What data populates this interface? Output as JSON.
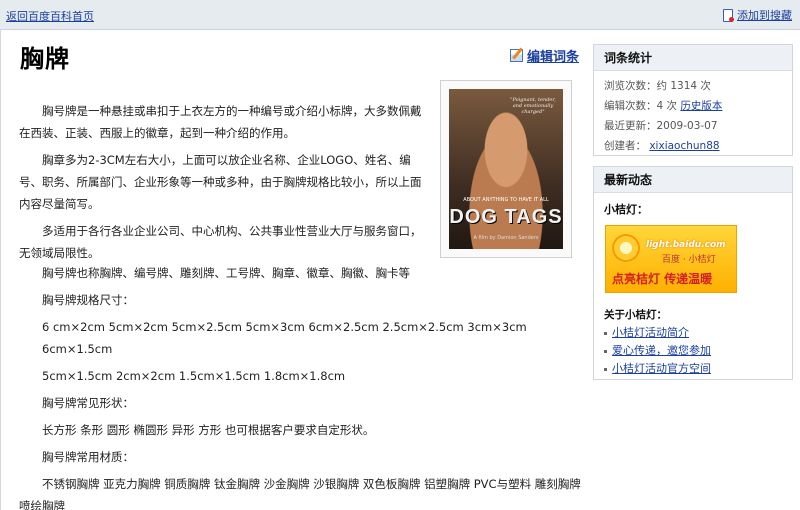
{
  "topbar": {
    "home_link": "返回百度百科首页",
    "favorite_link": "添加到搜藏"
  },
  "entry": {
    "title": "胸牌",
    "edit_label": "编辑词条"
  },
  "poster": {
    "quote": "\"Poignant, tender, and emotionally charged\"",
    "tags_line": "ABOUT ANYTHING TO HAVE IT ALL",
    "title": "DOG TAGS",
    "subtitle": "A film by Damion Sanders"
  },
  "article": {
    "p1": "胸号牌是一种悬挂或串扣于上衣左方的一种编号或介绍小标牌，大多数佩戴在西装、正装、西服上的徽章，起到一种介绍的作用。",
    "p2": "胸章多为2-3CM左右大小，上面可以放企业名称、企业LOGO、姓名、编号、职务、所属部门、企业形象等一种或多种，由于胸牌规格比较小，所以上面内容尽量简写。",
    "p3": "多适用于各行各业企业公司、中心机构、公共事业性营业大厅与服务窗口，无领域局限性。",
    "p4": "胸号牌也称胸牌、编号牌、雕刻牌、工号牌、胸章、徽章、胸徽、胸卡等",
    "p5": "胸号牌规格尺寸：",
    "spec1": "6 cm×2cm 5cm×2cm 5cm×2.5cm 5cm×3cm 6cm×2.5cm 2.5cm×2.5cm 3cm×3cm 6cm×1.5cm",
    "spec2": "5cm×1.5cm 2cm×2cm 1.5cm×1.5cm 1.8cm×1.8cm",
    "p6": "胸号牌常见形状：",
    "shapes": "长方形 条形 圆形 椭圆形 异形 方形 也可根据客户要求自定形状。",
    "p7": "胸号牌常用材质：",
    "materials": "不锈钢胸牌 亚克力胸牌 铜质胸牌 钛金胸牌 沙金胸牌 沙银胸牌 双色板胸牌 铝塑胸牌 PVC与塑料 雕刻胸牌 喷绘胸牌"
  },
  "stats": {
    "heading": "词条统计",
    "views_label": "浏览次数：约 1314 次",
    "edits_label": "编辑次数：4 次",
    "history_link": "历史版本",
    "updated_label": "最近更新：2009-03-07",
    "creator_label": "创建者：",
    "creator_link": "xixiaochun88"
  },
  "news": {
    "heading": "最新动态",
    "label": "小桔灯：",
    "banner_url": "light.baidu.com",
    "banner_sub": "百度 · 小桔灯",
    "banner_slogan": "点亮桔灯 传递温暖",
    "about_label": "关于小桔灯：",
    "links": [
      "小桔灯活动简介",
      "爱心传递，邀您参加",
      "小桔灯活动官方空间"
    ]
  }
}
